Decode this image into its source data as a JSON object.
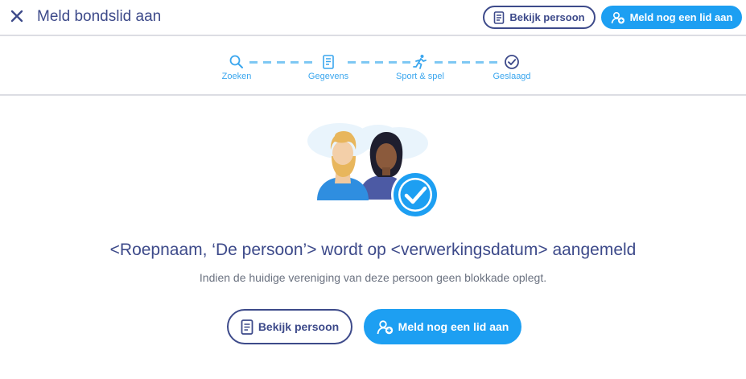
{
  "header": {
    "title": "Meld bondslid aan",
    "view_button": "Bekijk persoon",
    "add_button": "Meld nog een lid aan"
  },
  "stepper": {
    "steps": [
      {
        "label": "Zoeken",
        "icon": "search-icon"
      },
      {
        "label": "Gegevens",
        "icon": "document-icon"
      },
      {
        "label": "Sport & spel",
        "icon": "running-icon"
      },
      {
        "label": "Geslaagd",
        "icon": "check-circle-icon"
      }
    ]
  },
  "main": {
    "headline": "<Roepnaam, ‘De persoon’> wordt op <verwerkingsdatum> aangemeld",
    "subline": "Indien de huidige vereniging van deze persoon geen blokkade oplegt.",
    "view_button": "Bekijk persoon",
    "add_button": "Meld nog een lid aan"
  },
  "colors": {
    "navy": "#3d4a8a",
    "primary": "#1d9ff2",
    "step_accent": "#3aa6ee",
    "divider": "#dcdde3"
  }
}
